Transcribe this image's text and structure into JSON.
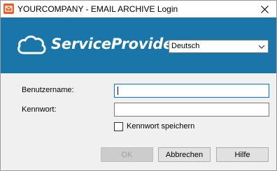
{
  "window": {
    "title": "YOURCOMPANY - EMAIL ARCHIVE Login",
    "close_symbol": "✕"
  },
  "banner": {
    "brand_text": "ServiceProvider",
    "logo_icon": "cloud-icon",
    "language": {
      "selected": "Deutsch"
    }
  },
  "form": {
    "username_label": "Benutzername:",
    "username_value": "",
    "password_label": "Kennwort:",
    "password_value": "",
    "remember_label": "Kennwort speichern",
    "remember_checked": false
  },
  "buttons": {
    "ok": "OK",
    "cancel": "Abbrechen",
    "help": "Hilfe"
  },
  "colors": {
    "banner": "#1a76a8",
    "app_icon": "#e8612c",
    "focus": "#0078d7"
  }
}
